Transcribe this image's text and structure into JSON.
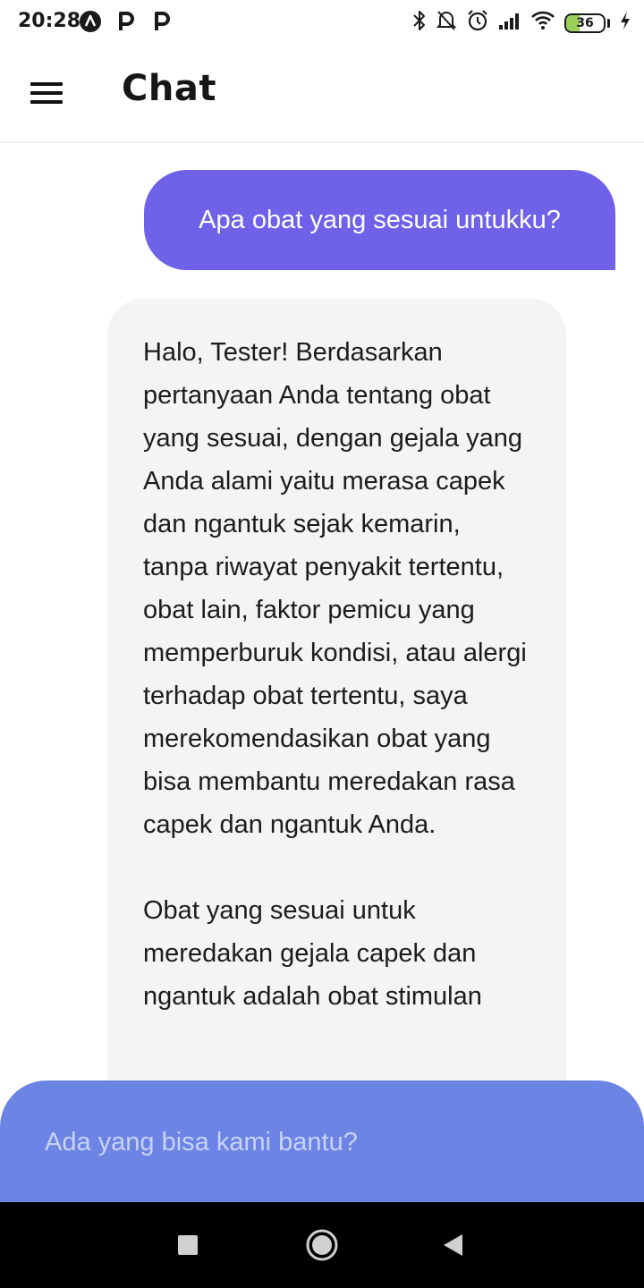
{
  "status_bar": {
    "time": "20:28",
    "battery_level": "36",
    "battery_fraction": 0.36,
    "notification_icons": [
      "vpn-a-icon",
      "p-icon",
      "p-icon"
    ],
    "system_icons": [
      "bluetooth-icon",
      "mute-icon",
      "alarm-icon",
      "signal-icon",
      "wifi-icon",
      "battery-icon",
      "charging-icon"
    ]
  },
  "header": {
    "title": "Chat",
    "menu_icon": "hamburger-menu-icon"
  },
  "messages": [
    {
      "role": "user",
      "text": "Apa obat yang sesuai untukku?"
    },
    {
      "role": "assistant",
      "paragraphs": [
        "Halo, Tester! Berdasarkan pertanyaan Anda tentang obat yang sesuai, dengan gejala yang Anda alami yaitu merasa capek dan ngantuk sejak kemarin, tanpa riwayat penyakit tertentu, obat lain, faktor pemicu yang memperburuk kondisi, atau alergi terhadap obat tertentu, saya merekomendasikan obat yang bisa membantu meredakan rasa capek dan ngantuk Anda.",
        "Obat yang sesuai untuk meredakan gejala capek dan ngantuk adalah obat stimulan"
      ]
    }
  ],
  "input": {
    "placeholder": "Ada yang bisa kami bantu?"
  },
  "nav_bar": {
    "icons": [
      "recent-apps-icon",
      "home-icon",
      "back-icon"
    ]
  },
  "colors": {
    "user_bubble": "#6f62e8",
    "bot_bubble": "#f4f4f6",
    "input_bar": "#6c85e4",
    "battery_fill": "#9ad05a"
  }
}
